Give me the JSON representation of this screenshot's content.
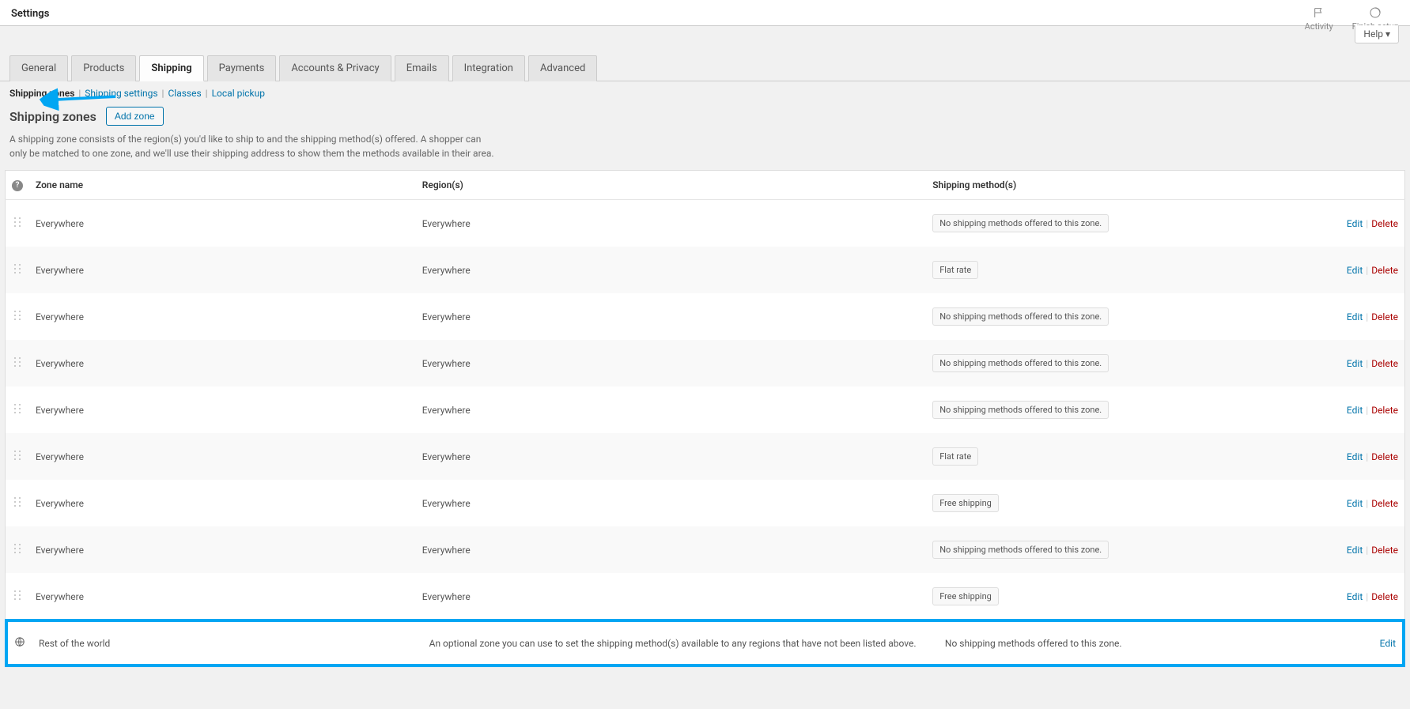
{
  "header": {
    "title": "Settings",
    "activity_label": "Activity",
    "finish_setup_label": "Finish setup",
    "help_label": "Help ▾"
  },
  "tabs": [
    {
      "label": "General",
      "active": false
    },
    {
      "label": "Products",
      "active": false
    },
    {
      "label": "Shipping",
      "active": true
    },
    {
      "label": "Payments",
      "active": false
    },
    {
      "label": "Accounts & Privacy",
      "active": false
    },
    {
      "label": "Emails",
      "active": false
    },
    {
      "label": "Integration",
      "active": false
    },
    {
      "label": "Advanced",
      "active": false
    }
  ],
  "subnav": {
    "zones": "Shipping zones",
    "settings": "Shipping settings",
    "classes": "Classes",
    "pickup": "Local pickup"
  },
  "heading": {
    "title": "Shipping zones",
    "add_button": "Add zone",
    "description": "A shipping zone consists of the region(s) you'd like to ship to and the shipping method(s) offered. A shopper can only be matched to one zone, and we'll use their shipping address to show them the methods available in their area."
  },
  "table": {
    "columns": {
      "zone_name": "Zone name",
      "regions": "Region(s)",
      "methods": "Shipping method(s)"
    },
    "no_methods_text": "No shipping methods offered to this zone.",
    "flat_rate_text": "Flat rate",
    "free_shipping_text": "Free shipping",
    "edit": "Edit",
    "delete": "Delete",
    "rows": [
      {
        "name": "Everywhere",
        "region": "Everywhere",
        "methods": [
          "no_methods"
        ]
      },
      {
        "name": "Everywhere",
        "region": "Everywhere",
        "methods": [
          "flat_rate"
        ]
      },
      {
        "name": "Everywhere",
        "region": "Everywhere",
        "methods": [
          "no_methods"
        ]
      },
      {
        "name": "Everywhere",
        "region": "Everywhere",
        "methods": [
          "no_methods"
        ]
      },
      {
        "name": "Everywhere",
        "region": "Everywhere",
        "methods": [
          "no_methods"
        ]
      },
      {
        "name": "Everywhere",
        "region": "Everywhere",
        "methods": [
          "flat_rate"
        ]
      },
      {
        "name": "Everywhere",
        "region": "Everywhere",
        "methods": [
          "free_shipping"
        ]
      },
      {
        "name": "Everywhere",
        "region": "Everywhere",
        "methods": [
          "no_methods"
        ]
      },
      {
        "name": "Everywhere",
        "region": "Everywhere",
        "methods": [
          "free_shipping"
        ]
      }
    ],
    "rest_of_world": {
      "name": "Rest of the world",
      "desc": "An optional zone you can use to set the shipping method(s) available to any regions that have not been listed above.",
      "method": "No shipping methods offered to this zone."
    }
  },
  "colors": {
    "accent": "#0073aa",
    "danger": "#a00",
    "highlight": "#00a6f3"
  }
}
